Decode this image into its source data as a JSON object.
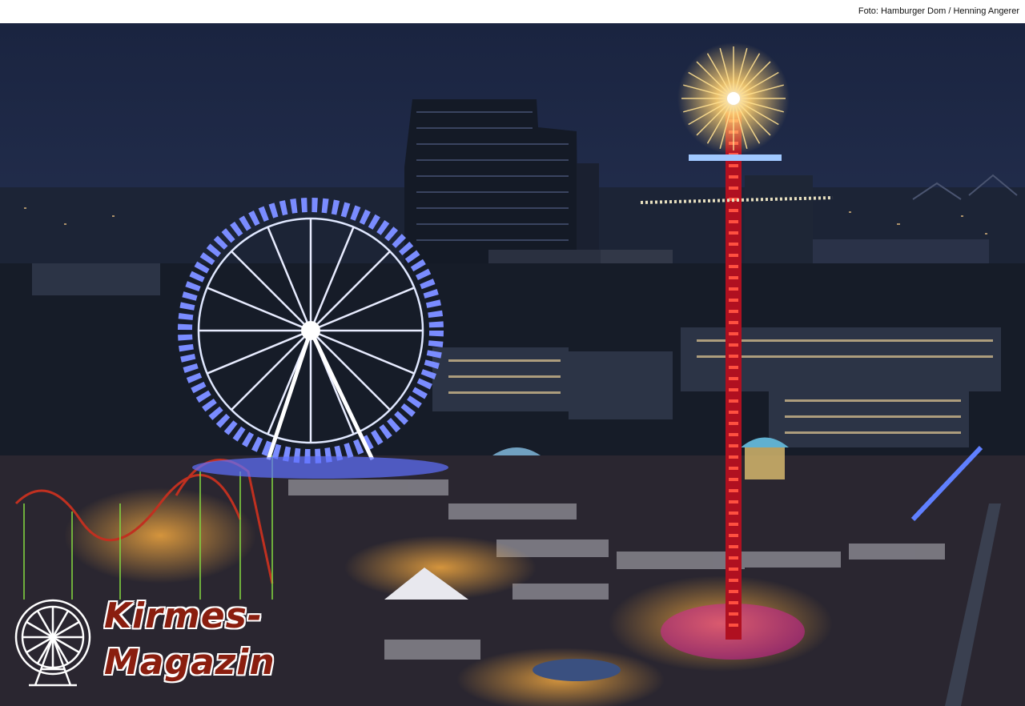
{
  "photo_credit": "Foto: Hamburger Dom / Henning Angerer",
  "logo": {
    "line1": "Kirmes-",
    "line2": "Magazin",
    "icon": "ferris-wheel-icon"
  },
  "colors": {
    "sky": "#1f2a44",
    "logo_text": "#8a1e0f",
    "wheel_lights": "#7a8cff",
    "tower_lights": "#ff3030"
  }
}
